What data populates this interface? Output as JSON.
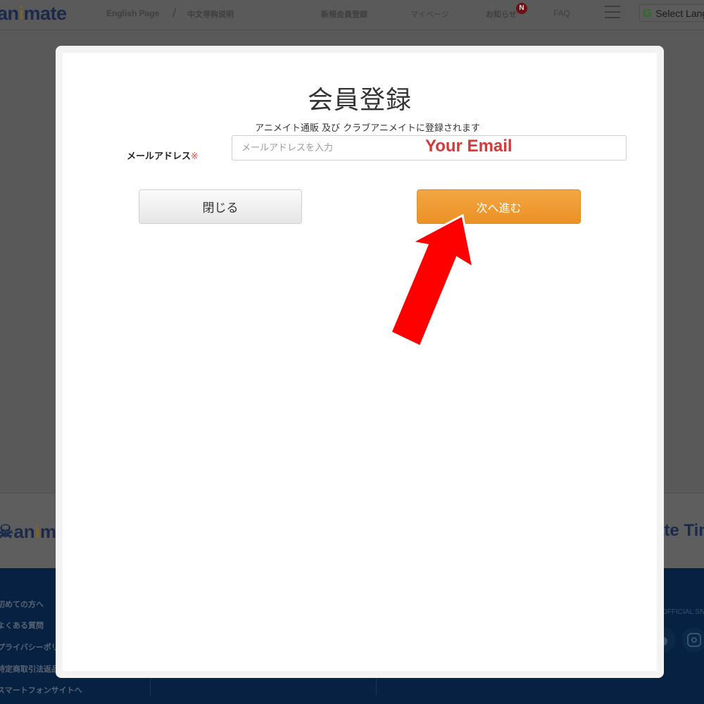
{
  "header": {
    "logo": {
      "prefix": "an",
      "highlight": "i",
      "suffix": "mate"
    },
    "links": [
      {
        "label": "English Page"
      },
      {
        "label": "中文导购说明"
      },
      {
        "label": "新規会員登録"
      },
      {
        "label": "マイページ"
      },
      {
        "label": "お知らせ"
      },
      {
        "label": "FAQ"
      }
    ],
    "separator": "/",
    "notification_badge": "N",
    "language_select": {
      "icon": "google-g-icon",
      "label": "Select Language"
    }
  },
  "background": {
    "footer_logo_left": {
      "prefix": "an",
      "highlight": "i",
      "suffix": "m"
    },
    "footer_logo_right": "ate Times",
    "footer_links": [
      "初めての方へ",
      "よくある質問",
      "プライバシーポリシー",
      "特定商取引法返品",
      "スマートフォンサイトへ"
    ],
    "sns_label": "OFFICIAL SNS",
    "sns_icons": [
      "line-icon",
      "instagram-icon"
    ]
  },
  "modal": {
    "title": "会員登録",
    "subtitle": "アニメイト通販 及び クラブアニメイトに登録されます",
    "email_label": "メールアドレス",
    "required_mark": "※",
    "email_value": "",
    "email_placeholder": "メールアドレスを入力",
    "close_button": "閉じる",
    "next_button": "次へ進む"
  },
  "annotation": {
    "email_hint": "Your Email",
    "arrow_color": "#ff0000",
    "hint_color": "#d33a3a"
  },
  "colors": {
    "primary_button": "#ec9125",
    "footer_bg": "#062142",
    "overlay": "#595959"
  }
}
